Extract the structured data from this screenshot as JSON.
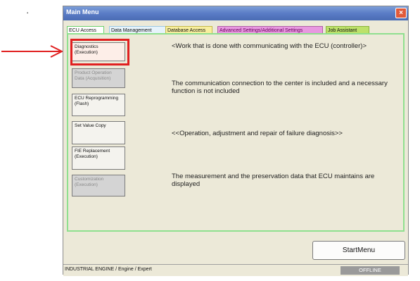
{
  "bullet": "·",
  "window": {
    "title": "Main Menu",
    "close_glyph": "×"
  },
  "tabs": [
    {
      "label": "ECU Access"
    },
    {
      "label": "Data Management"
    },
    {
      "label": "Database Access"
    },
    {
      "label": "Advanced Settings/Additional Settings"
    },
    {
      "label": "Job Assistant"
    }
  ],
  "menu_buttons": [
    {
      "label": "Diagnostics (Execution)",
      "state": "active"
    },
    {
      "label": "Product Operation Data (Acquisition)",
      "state": "disabled"
    },
    {
      "label": "ECU Reprogramming (Flash)",
      "state": "enabled"
    },
    {
      "label": "Set Value Copy",
      "state": "enabled"
    },
    {
      "label": "FIE Replacement (Execution)",
      "state": "enabled"
    },
    {
      "label": "Customization (Execution)",
      "state": "disabled"
    }
  ],
  "descriptions": [
    "<Work that is done with communicating with the ECU (controller)>",
    "The communication connection to the center is included and a necessary function is not included",
    "<<Operation, adjustment and repair of failure diagnosis>>",
    "The measurement and the preservation data that ECU maintains are displayed"
  ],
  "start_menu_label": "StartMenu",
  "status": {
    "text": "INDUSTRIAL ENGINE / Engine / Expert",
    "connection": "OFFLINE"
  },
  "colors": {
    "highlight": "#e02020",
    "panel_border": "#8fe08f",
    "titlebar": "#5a7cc6"
  }
}
